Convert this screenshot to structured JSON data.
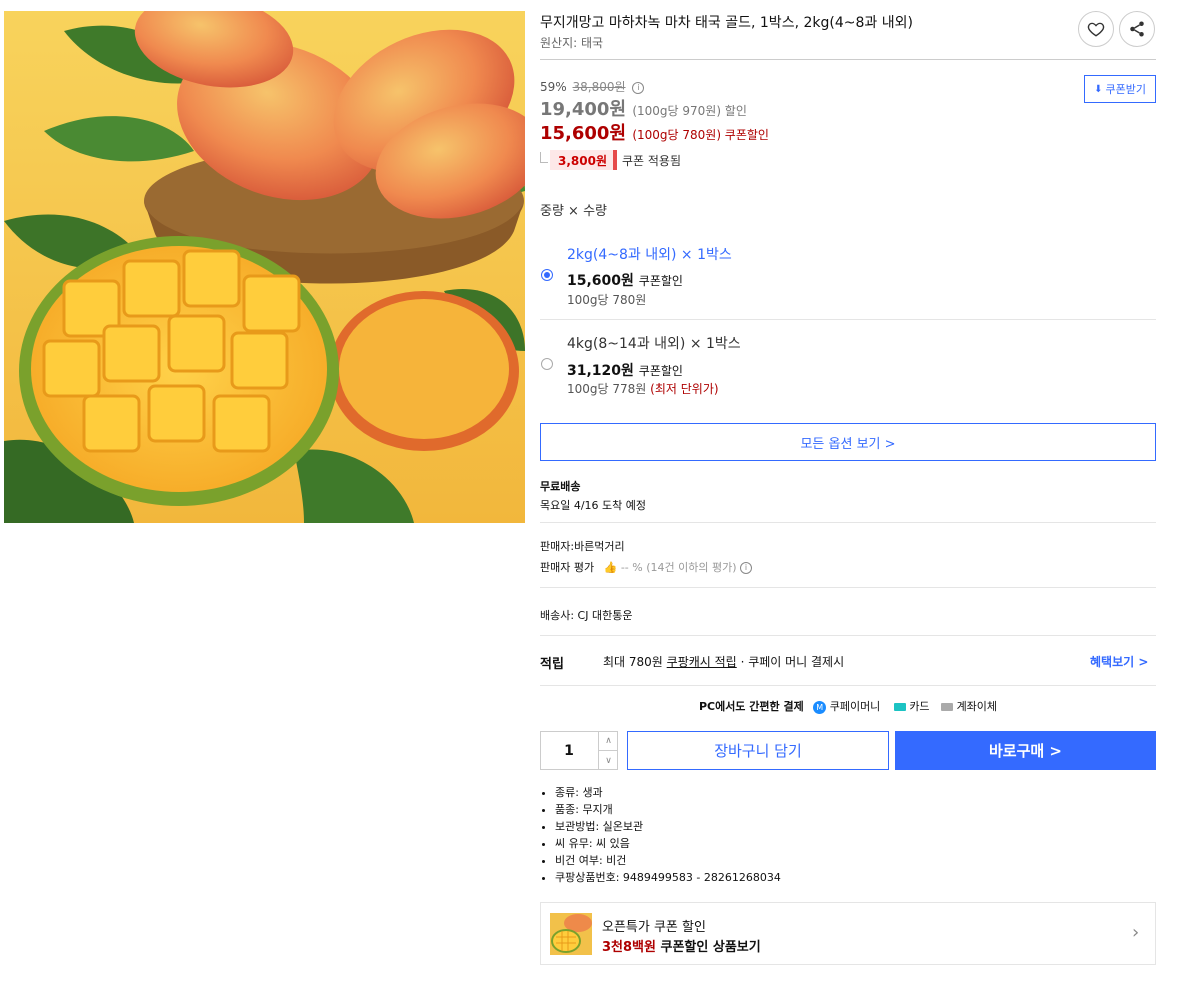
{
  "product": {
    "title": "무지개망고 마하차녹 마차 태국 골드, 1박스, 2kg(4~8과 내외)",
    "origin": "원산지: 태국"
  },
  "price": {
    "discount_rate": "59%",
    "original_price": "38,800원",
    "sale_price": "19,400원",
    "sale_unit": "(100g당 970원) 할인",
    "coupon_price": "15,600원",
    "coupon_unit": "(100g당 780원) 쿠폰할인",
    "coupon_tag": "3,800원",
    "coupon_applied": "쿠폰 적용됨",
    "coupon_download": "쿠폰받기"
  },
  "options": {
    "heading": "중량 × 수량",
    "items": [
      {
        "name": "2kg(4~8과 내외) × 1박스",
        "price": "15,600원",
        "price_note": "쿠폰할인",
        "unit_price": "100g당 780원",
        "unit_note": "",
        "selected": true
      },
      {
        "name": "4kg(8~14과 내외) × 1박스",
        "price": "31,120원",
        "price_note": "쿠폰할인",
        "unit_price": "100g당 778원",
        "unit_note": "(최저 단위가)",
        "selected": false
      }
    ],
    "all_options": "모든 옵션 보기 >"
  },
  "shipping": {
    "label": "무료배송",
    "arrival": "목요일 4/16 도착 예정"
  },
  "seller": {
    "name": "판매자:바른먹거리",
    "rating_label": "판매자 평가",
    "rating_value": "-- % (14건 이하의 평가)"
  },
  "carrier": "배송사:  CJ 대한통운",
  "rewards": {
    "label": "적립",
    "text_prefix": "최대 780원",
    "text_link": "쿠팡캐시 적립",
    "text_suffix": "· 쿠페이 머니 결제시",
    "benefit_link": "혜택보기 >"
  },
  "payment": {
    "title": "PC에서도 간편한 결제",
    "methods": [
      "쿠페이머니",
      "카드",
      "계좌이체"
    ]
  },
  "purchase": {
    "quantity": "1",
    "cart": "장바구니 담기",
    "buy": "바로구매 >"
  },
  "attributes": [
    "종류: 생과",
    "품종: 무지개",
    "보관방법: 실온보관",
    "씨 유무: 씨 있음",
    "비건 여부: 비건",
    "쿠팡상품번호: 9489499583 - 28261268034"
  ],
  "promo": {
    "line1": "오픈특가 쿠폰 할인",
    "highlight": "3천8백원",
    "line2_rest": " 쿠폰할인 상품보기"
  },
  "colors": {
    "accent": "#346aff",
    "price_red": "#ae0000"
  }
}
